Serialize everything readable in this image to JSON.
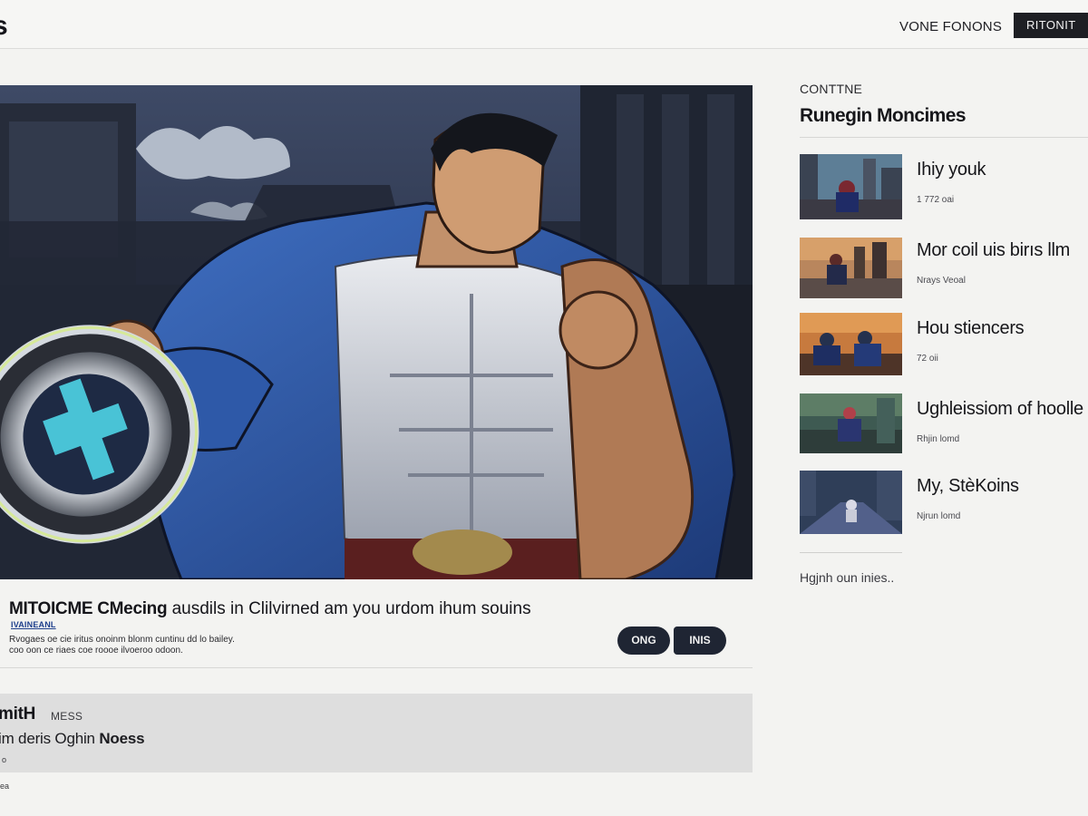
{
  "header": {
    "logo": "s",
    "nav_link": "VONE FONONS",
    "nav_button": "RITONIT"
  },
  "hero": {
    "image_subject": "comic-style muscular hero in blue shirt holding a large metal shield with a cyan glowing emblem"
  },
  "video": {
    "title_lead": "MITOICME CMecing",
    "title_rest": " ausdils  in Clilvirned am you urdom ihum souins",
    "channel": "IVAINEANL",
    "description_line1": "Rvogaes oe cie iritus onoinm blonm cuntinu dd lo bailey.",
    "description_line2": "coo oon ce riaes coe roooe ilvoeroo odoon.",
    "button_one": "ONG",
    "button_two": "INIS"
  },
  "lower_panel": {
    "heading": "mitH",
    "kicker": "MESS",
    "subtitle_lead": "im deris Oghin ",
    "subtitle_strong": "Noess",
    "foot": "o"
  },
  "page_foot": "ea",
  "sidebar": {
    "kicker": "CONTTNE",
    "title": "Runegin Moncimes",
    "items": [
      {
        "title": "Ihiy youk",
        "meta": "1 772 oai"
      },
      {
        "title": "Mor coil uis birıs llm",
        "meta": "Nrays Veoal"
      },
      {
        "title": "Hou stiencers",
        "meta": "72 oii"
      },
      {
        "title": "Ughleissiom of hoolle",
        "meta": "Rhjin lomd"
      },
      {
        "title": "My, StèKoins",
        "meta": "Njrun lomd"
      }
    ],
    "more_link": "Hgjnh oun inies.."
  },
  "colors": {
    "background": "#f3f3f1",
    "dark_button": "#1e1f24",
    "pill": "#1f2533",
    "panel": "#dedede",
    "hero_shirt": "#2e59a8",
    "shield_emblem": "#49c3d6"
  }
}
